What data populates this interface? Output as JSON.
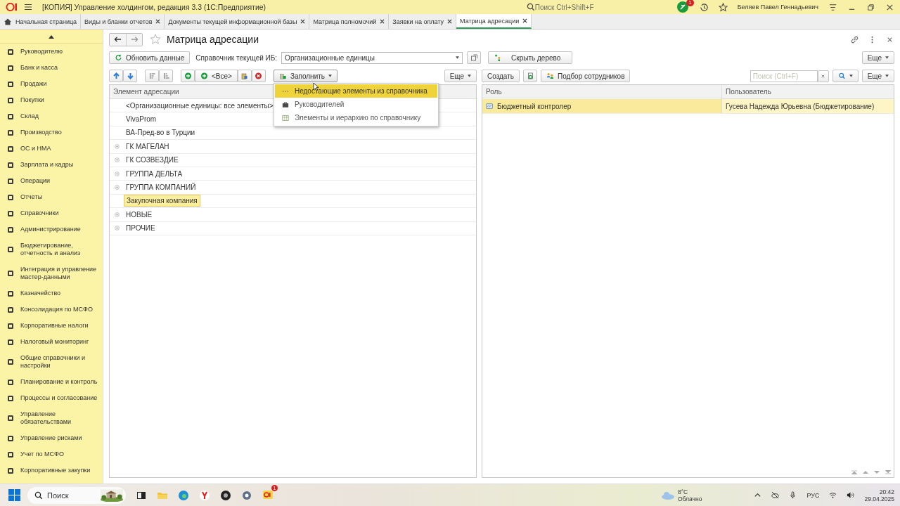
{
  "window": {
    "title": "[КОПИЯ] Управление холдингом, редакция 3.3  (1С:Предприятие)",
    "search_placeholder": "Поиск Ctrl+Shift+F",
    "notifications": "1",
    "user": "Беляев Павел Геннадьевич"
  },
  "tabs": [
    {
      "label": "Начальная страница",
      "selected": false,
      "kind": "home"
    },
    {
      "label": "Виды и бланки отчетов",
      "selected": false,
      "kind": "closable"
    },
    {
      "label": "Документы текущей информационной базы",
      "selected": false,
      "kind": "closable"
    },
    {
      "label": "Матрица полномочий",
      "selected": false,
      "kind": "closable"
    },
    {
      "label": "Заявки на оплату",
      "selected": false,
      "kind": "closable"
    },
    {
      "label": "Матрица адресации",
      "selected": true,
      "kind": "closable"
    }
  ],
  "sidebar": {
    "items": [
      {
        "label": "Руководителю"
      },
      {
        "label": "Банк и касса"
      },
      {
        "label": "Продажи"
      },
      {
        "label": "Покупки"
      },
      {
        "label": "Склад"
      },
      {
        "label": "Производство"
      },
      {
        "label": "ОС и НМА"
      },
      {
        "label": "Зарплата и кадры"
      },
      {
        "label": "Операции"
      },
      {
        "label": "Отчеты"
      },
      {
        "label": "Справочники"
      },
      {
        "label": "Администрирование"
      },
      {
        "label": "Бюджетирование, отчетность и анализ"
      },
      {
        "label": "Интеграция и управление мастер-данными"
      },
      {
        "label": "Казначейство"
      },
      {
        "label": "Консолидация по МСФО"
      },
      {
        "label": "Корпоративные налоги"
      },
      {
        "label": "Налоговый мониторинг"
      },
      {
        "label": "Общие справочники и настройки"
      },
      {
        "label": "Планирование и контроль"
      },
      {
        "label": "Процессы и согласование"
      },
      {
        "label": "Управление обязательствами"
      },
      {
        "label": "Управление рисками"
      },
      {
        "label": "Учет по МСФО"
      },
      {
        "label": "Корпоративные закупки"
      }
    ]
  },
  "form": {
    "title": "Матрица адресации",
    "refresh_button": "Обновить данные",
    "catalog_label": "Справочник текущей ИБ:",
    "catalog_value": "Организационные единицы",
    "hide_tree_button": "Скрыть дерево",
    "more_button": "Еще"
  },
  "left_toolbar": {
    "all_button": "<Все>",
    "fill_button": "Заполнить",
    "more_button": "Еще"
  },
  "fill_menu": [
    {
      "label": "Недостающие элементы из справочника",
      "selected": true,
      "kind": "dots"
    },
    {
      "label": "Руководителей",
      "selected": false,
      "kind": "case"
    },
    {
      "label": "Элементы и иерархию по справочнику",
      "selected": false,
      "kind": "table"
    }
  ],
  "left_table": {
    "columns": [
      "Элемент адресации"
    ],
    "rows": [
      {
        "label": "<Организационные единицы: все элементы>",
        "group": false,
        "selected": false
      },
      {
        "label": "VivaProm",
        "group": false,
        "selected": false
      },
      {
        "label": "ВА-Пред-во в Турции",
        "group": false,
        "selected": false
      },
      {
        "label": "ГК МАГЕЛАН",
        "group": true,
        "selected": false
      },
      {
        "label": "ГК СОЗВЕЗДИЕ",
        "group": true,
        "selected": false
      },
      {
        "label": "ГРУППА ДЕЛЬТА",
        "group": true,
        "selected": false
      },
      {
        "label": "ГРУППА КОМПАНИЙ",
        "group": true,
        "selected": false
      },
      {
        "label": "Закупочная компания",
        "group": false,
        "selected": true
      },
      {
        "label": "НОВЫЕ",
        "group": true,
        "selected": false
      },
      {
        "label": "ПРОЧИЕ",
        "group": true,
        "selected": false
      }
    ]
  },
  "right_toolbar": {
    "create_button": "Создать",
    "pick_button": "Подбор сотрудников",
    "search_placeholder": "Поиск (Ctrl+F)",
    "more_button": "Еще"
  },
  "right_table": {
    "columns": [
      "Роль",
      "Пользователь"
    ],
    "rows": [
      {
        "role": "Бюджетный контролер",
        "user": "Гусева Надежда Юрьевна (Бюджетирование)",
        "selected": true
      }
    ]
  },
  "taskbar": {
    "search_placeholder": "Поиск",
    "app_badge": "1",
    "temperature": "8°C",
    "weather": "Облачно",
    "language": "РУС",
    "time": "20:42",
    "date": "29.04.2025"
  }
}
